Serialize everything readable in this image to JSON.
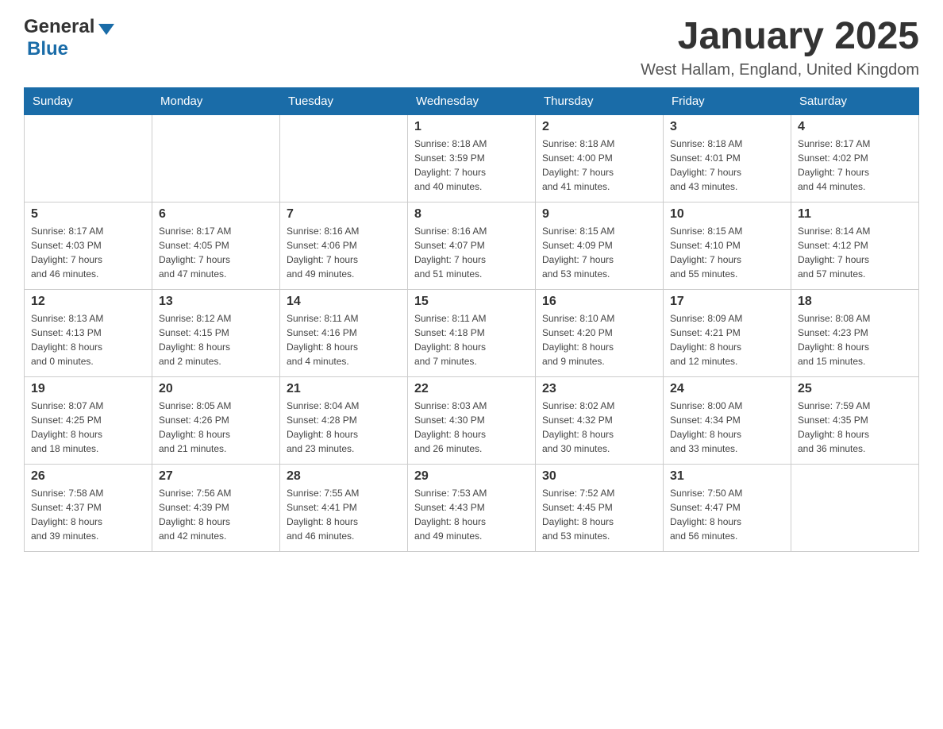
{
  "logo": {
    "general": "General",
    "blue": "Blue"
  },
  "header": {
    "month": "January 2025",
    "location": "West Hallam, England, United Kingdom"
  },
  "days_of_week": [
    "Sunday",
    "Monday",
    "Tuesday",
    "Wednesday",
    "Thursday",
    "Friday",
    "Saturday"
  ],
  "weeks": [
    [
      {
        "day": "",
        "info": ""
      },
      {
        "day": "",
        "info": ""
      },
      {
        "day": "",
        "info": ""
      },
      {
        "day": "1",
        "info": "Sunrise: 8:18 AM\nSunset: 3:59 PM\nDaylight: 7 hours\nand 40 minutes."
      },
      {
        "day": "2",
        "info": "Sunrise: 8:18 AM\nSunset: 4:00 PM\nDaylight: 7 hours\nand 41 minutes."
      },
      {
        "day": "3",
        "info": "Sunrise: 8:18 AM\nSunset: 4:01 PM\nDaylight: 7 hours\nand 43 minutes."
      },
      {
        "day": "4",
        "info": "Sunrise: 8:17 AM\nSunset: 4:02 PM\nDaylight: 7 hours\nand 44 minutes."
      }
    ],
    [
      {
        "day": "5",
        "info": "Sunrise: 8:17 AM\nSunset: 4:03 PM\nDaylight: 7 hours\nand 46 minutes."
      },
      {
        "day": "6",
        "info": "Sunrise: 8:17 AM\nSunset: 4:05 PM\nDaylight: 7 hours\nand 47 minutes."
      },
      {
        "day": "7",
        "info": "Sunrise: 8:16 AM\nSunset: 4:06 PM\nDaylight: 7 hours\nand 49 minutes."
      },
      {
        "day": "8",
        "info": "Sunrise: 8:16 AM\nSunset: 4:07 PM\nDaylight: 7 hours\nand 51 minutes."
      },
      {
        "day": "9",
        "info": "Sunrise: 8:15 AM\nSunset: 4:09 PM\nDaylight: 7 hours\nand 53 minutes."
      },
      {
        "day": "10",
        "info": "Sunrise: 8:15 AM\nSunset: 4:10 PM\nDaylight: 7 hours\nand 55 minutes."
      },
      {
        "day": "11",
        "info": "Sunrise: 8:14 AM\nSunset: 4:12 PM\nDaylight: 7 hours\nand 57 minutes."
      }
    ],
    [
      {
        "day": "12",
        "info": "Sunrise: 8:13 AM\nSunset: 4:13 PM\nDaylight: 8 hours\nand 0 minutes."
      },
      {
        "day": "13",
        "info": "Sunrise: 8:12 AM\nSunset: 4:15 PM\nDaylight: 8 hours\nand 2 minutes."
      },
      {
        "day": "14",
        "info": "Sunrise: 8:11 AM\nSunset: 4:16 PM\nDaylight: 8 hours\nand 4 minutes."
      },
      {
        "day": "15",
        "info": "Sunrise: 8:11 AM\nSunset: 4:18 PM\nDaylight: 8 hours\nand 7 minutes."
      },
      {
        "day": "16",
        "info": "Sunrise: 8:10 AM\nSunset: 4:20 PM\nDaylight: 8 hours\nand 9 minutes."
      },
      {
        "day": "17",
        "info": "Sunrise: 8:09 AM\nSunset: 4:21 PM\nDaylight: 8 hours\nand 12 minutes."
      },
      {
        "day": "18",
        "info": "Sunrise: 8:08 AM\nSunset: 4:23 PM\nDaylight: 8 hours\nand 15 minutes."
      }
    ],
    [
      {
        "day": "19",
        "info": "Sunrise: 8:07 AM\nSunset: 4:25 PM\nDaylight: 8 hours\nand 18 minutes."
      },
      {
        "day": "20",
        "info": "Sunrise: 8:05 AM\nSunset: 4:26 PM\nDaylight: 8 hours\nand 21 minutes."
      },
      {
        "day": "21",
        "info": "Sunrise: 8:04 AM\nSunset: 4:28 PM\nDaylight: 8 hours\nand 23 minutes."
      },
      {
        "day": "22",
        "info": "Sunrise: 8:03 AM\nSunset: 4:30 PM\nDaylight: 8 hours\nand 26 minutes."
      },
      {
        "day": "23",
        "info": "Sunrise: 8:02 AM\nSunset: 4:32 PM\nDaylight: 8 hours\nand 30 minutes."
      },
      {
        "day": "24",
        "info": "Sunrise: 8:00 AM\nSunset: 4:34 PM\nDaylight: 8 hours\nand 33 minutes."
      },
      {
        "day": "25",
        "info": "Sunrise: 7:59 AM\nSunset: 4:35 PM\nDaylight: 8 hours\nand 36 minutes."
      }
    ],
    [
      {
        "day": "26",
        "info": "Sunrise: 7:58 AM\nSunset: 4:37 PM\nDaylight: 8 hours\nand 39 minutes."
      },
      {
        "day": "27",
        "info": "Sunrise: 7:56 AM\nSunset: 4:39 PM\nDaylight: 8 hours\nand 42 minutes."
      },
      {
        "day": "28",
        "info": "Sunrise: 7:55 AM\nSunset: 4:41 PM\nDaylight: 8 hours\nand 46 minutes."
      },
      {
        "day": "29",
        "info": "Sunrise: 7:53 AM\nSunset: 4:43 PM\nDaylight: 8 hours\nand 49 minutes."
      },
      {
        "day": "30",
        "info": "Sunrise: 7:52 AM\nSunset: 4:45 PM\nDaylight: 8 hours\nand 53 minutes."
      },
      {
        "day": "31",
        "info": "Sunrise: 7:50 AM\nSunset: 4:47 PM\nDaylight: 8 hours\nand 56 minutes."
      },
      {
        "day": "",
        "info": ""
      }
    ]
  ]
}
